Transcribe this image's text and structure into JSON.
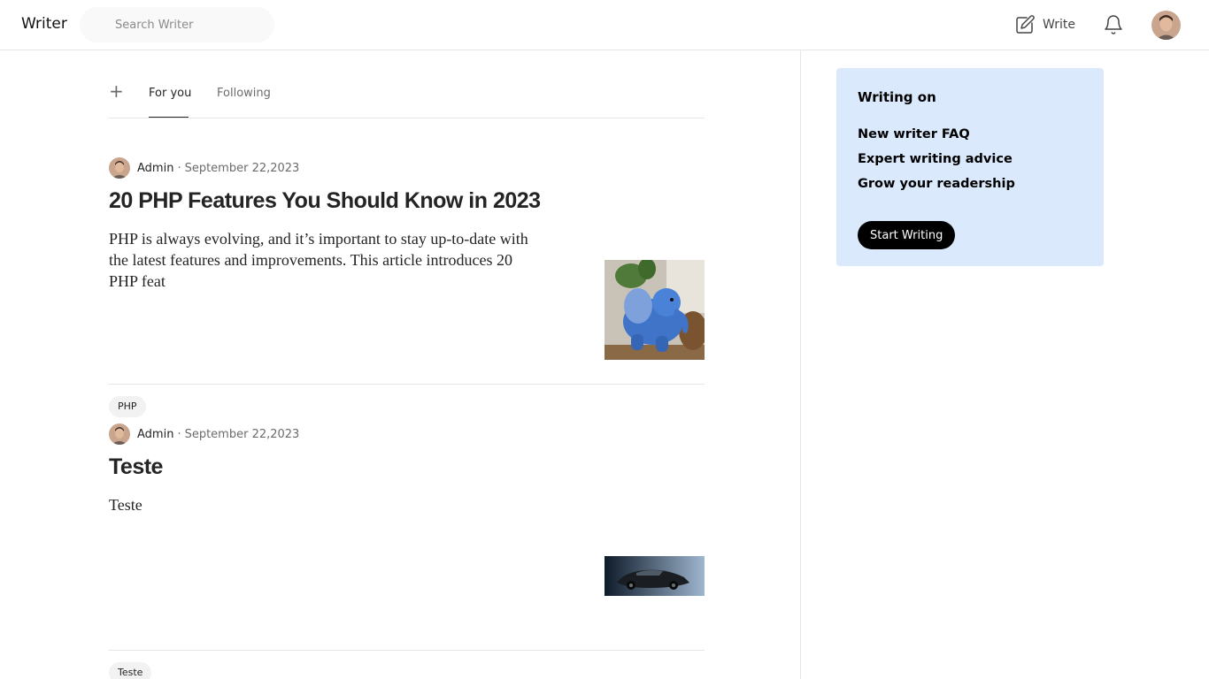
{
  "header": {
    "logo": "Writer",
    "search_placeholder": "Search Writer",
    "write_label": "Write",
    "icons": {
      "write": "pencil-square-icon",
      "notifications": "bell-icon",
      "profile": "avatar"
    }
  },
  "feed": {
    "tabs": [
      {
        "label": "+"
      },
      {
        "label": "For you",
        "active": true
      },
      {
        "label": "Following"
      }
    ],
    "articles": [
      {
        "author": "Admin",
        "separator": "·",
        "date": "September 22,2023",
        "title": "20 PHP Features You Should Know in 2023",
        "excerpt": "PHP is always evolving, and it’s important to stay up-to-date with the latest features and improvements. This article introduces 20 PHP feat",
        "tag": "PHP",
        "thumbnail": "blue-knitted-elephant-image"
      },
      {
        "author": "Admin",
        "separator": "·",
        "date": "September 22,2023",
        "title": "Teste",
        "excerpt": "Teste",
        "tag": "Teste",
        "thumbnail": "dark-sports-car-image"
      }
    ]
  },
  "sidebar": {
    "promo": {
      "title": "Writing on",
      "links": [
        "New writer FAQ",
        "Expert writing advice",
        "Grow your readership"
      ],
      "button": "Start Writing"
    }
  },
  "colors": {
    "promo_background": "#dbe9fd",
    "button_background": "#000000",
    "divider": "#e6e6e6"
  }
}
